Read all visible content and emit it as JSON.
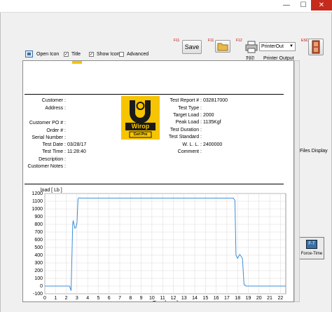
{
  "window": {
    "minimize_glyph": "—",
    "maximize_glyph": "☐",
    "close_glyph": "✕"
  },
  "toolbar": {
    "open_icon_label": "Open Icon",
    "title_label": "Title",
    "title_checked": true,
    "show_icon_label": "Show Icon",
    "show_icon_checked": true,
    "advanced_label": "Advanced",
    "advanced_checked": false,
    "save_fkey": "F11",
    "save_label": "Save",
    "open_fkey": "F11",
    "print_fkey": "F12",
    "print_label": "列印",
    "printer_value": "PrinterOut",
    "printer_output_label": "Printer Output",
    "exit_fkey": "ESC"
  },
  "report": {
    "left_fields": [
      {
        "label": "Customer :",
        "value": ""
      },
      {
        "label": "Address :",
        "value": ""
      },
      {
        "label": "Customer PO # :",
        "value": ""
      },
      {
        "label": "Order # :",
        "value": ""
      },
      {
        "label": "Serial Number :",
        "value": ""
      },
      {
        "label": "Test Date :",
        "value": "03/28/17"
      },
      {
        "label": "Test Time :",
        "value": "11:28:40"
      },
      {
        "label": "Description :",
        "value": ""
      },
      {
        "label": "Customer Notes :",
        "value": ""
      }
    ],
    "right_fields": [
      {
        "label": "Test Report # :",
        "value": "032817000"
      },
      {
        "label": "Test Type :",
        "value": ""
      },
      {
        "label": "Target Load :",
        "value": "2000"
      },
      {
        "label": "Peak Load :",
        "value": "1135Kgf"
      },
      {
        "label": "Test Duration :",
        "value": ""
      },
      {
        "label": "Test Standard :",
        "value": ""
      },
      {
        "label": "W. L. L. :",
        "value": "2400000"
      },
      {
        "label": "Comment :",
        "value": ""
      }
    ],
    "logo": {
      "text": "Wirop",
      "subtext": "Cert Pro"
    }
  },
  "side": {
    "files_display_label": "Files Display",
    "force_time_label": "Force-Time"
  },
  "chart_data": {
    "type": "line",
    "ylabel": "load [ Lb ]",
    "xlabel": "Time [ sec ]",
    "xlim": [
      0,
      22.5
    ],
    "ylim": [
      -100,
      1200
    ],
    "yticks": [
      -100,
      0,
      100,
      200,
      300,
      400,
      500,
      600,
      700,
      800,
      900,
      1000,
      1100,
      1200
    ],
    "xticks": [
      0,
      1,
      2,
      3,
      4,
      5,
      6,
      7,
      8,
      9,
      10,
      11,
      12,
      13,
      14,
      15,
      16,
      17,
      18,
      19,
      20,
      21,
      22
    ],
    "grid": true,
    "line_color": "#3b8ed8",
    "series": [
      {
        "x": [
          0,
          2.3,
          2.45,
          2.6,
          2.65,
          2.8,
          2.9,
          3.0,
          3.1,
          3.2,
          3.4,
          10,
          17.6,
          17.75,
          17.85,
          18.0,
          18.2,
          18.45,
          18.6,
          18.8,
          20,
          22.5
        ],
        "y": [
          0,
          0,
          -60,
          800,
          850,
          750,
          760,
          820,
          1130,
          1145,
          1140,
          1140,
          1140,
          1110,
          400,
          360,
          410,
          360,
          20,
          0,
          0,
          0
        ]
      }
    ]
  }
}
